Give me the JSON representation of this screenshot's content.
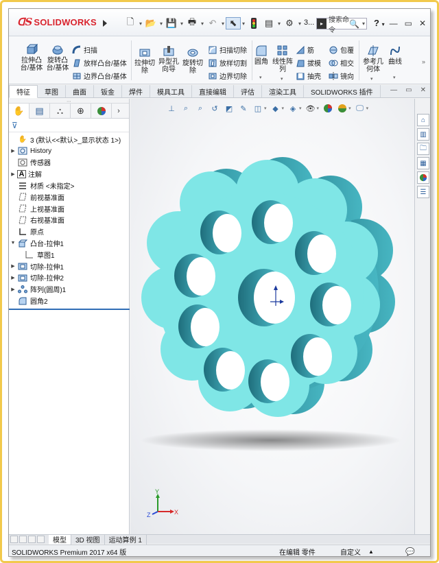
{
  "app": {
    "brand": "SOLIDWORKS",
    "document_name": "3...",
    "search_placeholder": "搜索命令",
    "help_label": "?"
  },
  "ribbon": {
    "extrude_boss": "拉伸凸\n台/基体",
    "revolve_boss": "旋转凸\n台/基体",
    "sweep_boss": "扫描",
    "loft_boss": "放样凸台/基体",
    "boundary_boss": "边界凸台/基体",
    "extrude_cut": "拉伸切\n除",
    "hole_wizard": "异型孔\n向导",
    "revolve_cut": "旋转切\n除",
    "sweep_cut": "扫描切除",
    "loft_cut": "放样切割",
    "boundary_cut": "边界切除",
    "fillet": "圆角",
    "linear_pattern": "线性阵\n列",
    "rib": "筋",
    "draft": "拔模",
    "shell": "抽壳",
    "wrap": "包覆",
    "intersect": "相交",
    "mirror": "镜向",
    "ref_geometry": "参考几\n何体",
    "curves": "曲线"
  },
  "tabs": [
    "特征",
    "草图",
    "曲面",
    "钣金",
    "焊件",
    "模具工具",
    "直接编辑",
    "评估",
    "渲染工具",
    "SOLIDWORKS 插件"
  ],
  "active_tab": "特征",
  "tree": {
    "root": "3  (默认<<默认>_显示状态 1>)",
    "items": [
      {
        "label": "History",
        "expandable": true
      },
      {
        "label": "传感器",
        "expandable": false
      },
      {
        "label": "注解",
        "expandable": true
      },
      {
        "label": "材质 <未指定>",
        "expandable": false
      },
      {
        "label": "前视基准面",
        "expandable": false
      },
      {
        "label": "上视基准面",
        "expandable": false
      },
      {
        "label": "右视基准面",
        "expandable": false
      },
      {
        "label": "原点",
        "expandable": false
      },
      {
        "label": "凸台-拉伸1",
        "expandable": true,
        "expanded": true
      },
      {
        "label": "草图1",
        "expandable": false,
        "child": true
      },
      {
        "label": "切除-拉伸1",
        "expandable": true
      },
      {
        "label": "切除-拉伸2",
        "expandable": true
      },
      {
        "label": "阵列(圆周)1",
        "expandable": true
      },
      {
        "label": "圆角2",
        "expandable": false
      }
    ]
  },
  "bottom_tabs": [
    "模型",
    "3D 视图",
    "运动算例 1"
  ],
  "active_bottom_tab": "模型",
  "status": {
    "product": "SOLIDWORKS Premium 2017 x64 版",
    "mode": "在编辑 零件",
    "units": "自定义"
  },
  "triad": {
    "x": "X",
    "y": "Y",
    "z": "Z"
  },
  "colors": {
    "part_face": "#7fe6e6",
    "part_side": "#3aa6b2",
    "accent": "#2f6db5",
    "brand_red": "#d9232d"
  }
}
